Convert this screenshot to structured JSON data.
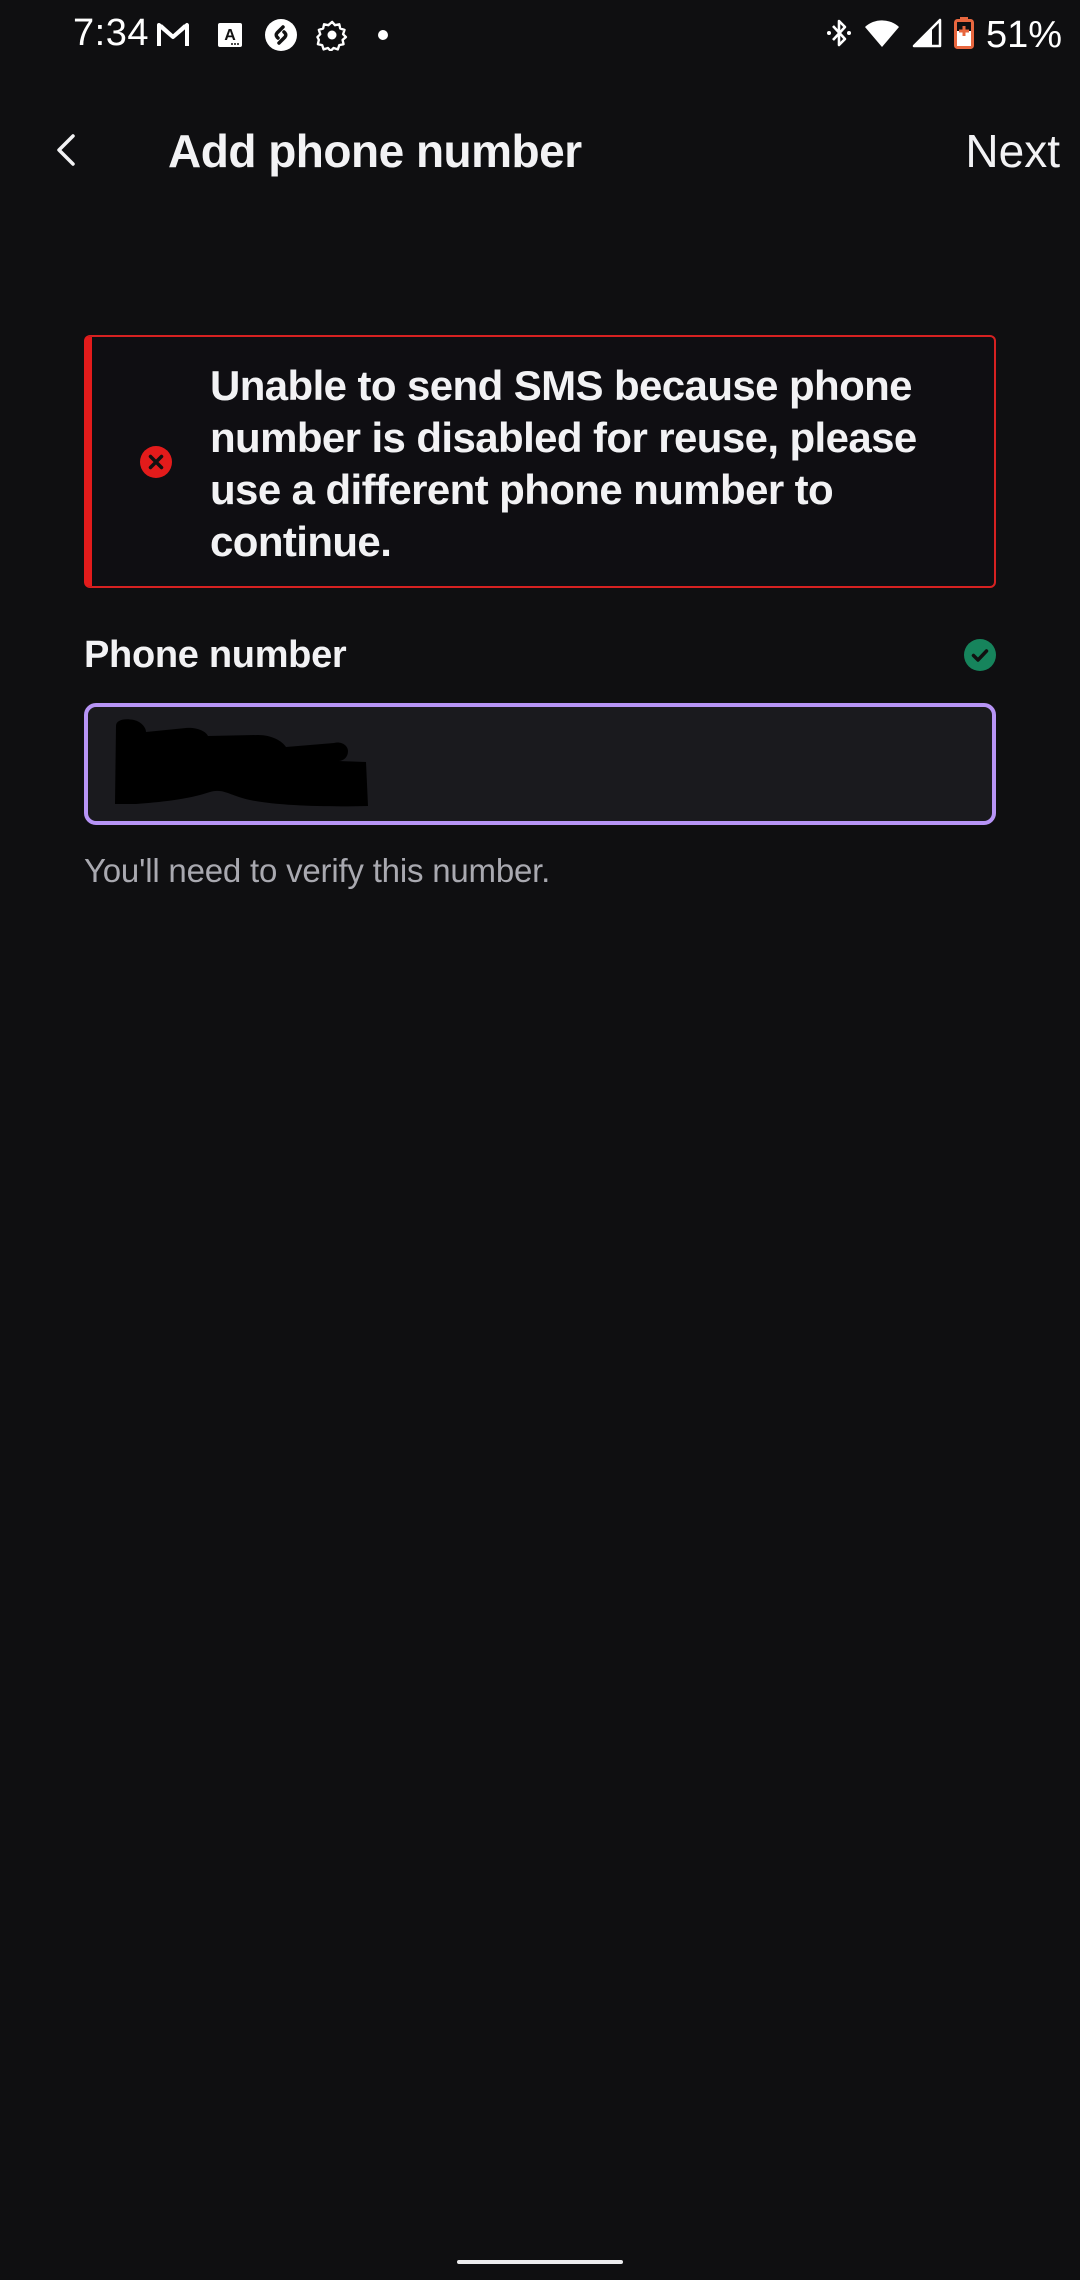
{
  "status_bar": {
    "time": "7:34",
    "left_icons": [
      "gmail-icon",
      "text-a-icon",
      "shazam-icon",
      "settings-gear-icon",
      "notification-dot-icon"
    ],
    "right_icons": [
      "bluetooth-icon",
      "wifi-icon",
      "cell-signal-icon",
      "battery-charging-icon"
    ],
    "battery_percent": "51%",
    "battery_color": "#e8673f"
  },
  "header": {
    "back_icon": "chevron-left-icon",
    "title": "Add phone number",
    "next_label": "Next"
  },
  "error_banner": {
    "icon": "error-x-circle-icon",
    "color": "#e31b1b",
    "message": "Unable to send SMS because phone number is disabled for reuse, please use a different phone number to continue."
  },
  "phone_field": {
    "label": "Phone number",
    "status_icon": "check-circle-icon",
    "status_color": "#16845c",
    "value": "",
    "value_redacted": true,
    "focus_color": "#b794f6",
    "helper_text": "You'll need to verify this number."
  }
}
